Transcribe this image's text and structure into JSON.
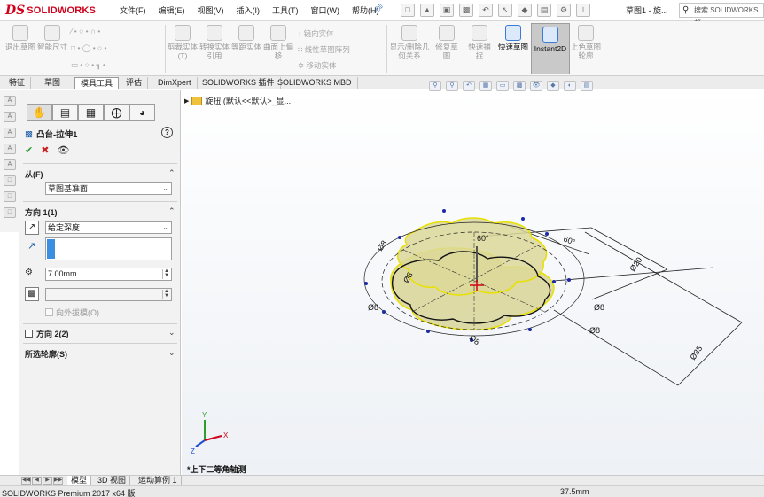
{
  "app": {
    "logo_ds": "DS",
    "logo_name": "SOLIDWORKS"
  },
  "menu": [
    "文件(F)",
    "编辑(E)",
    "视图(V)",
    "插入(I)",
    "工具(T)",
    "窗口(W)",
    "帮助(H)"
  ],
  "title": {
    "document": "草图1 - 旋...",
    "search_placeholder": "搜索 SOLIDWORKS 帮"
  },
  "ribbon": {
    "exit_sketch": "退出草图",
    "smart_dimension": "智能尺寸",
    "cut_entities": "剪裁实体(T)",
    "convert_entities": "转换实体引用",
    "offset_entities": "等距实体",
    "surface_offset": "曲面上偏移",
    "mirror_entities": "镜向实体",
    "linear_pattern": "线性草图阵列",
    "move_entities": "移动实体",
    "display_delete_relations": "显示/删除几何关系",
    "repair_sketch": "修复草图",
    "quick_snaps": "快速捕捉",
    "rapid_sketch": "快速草图",
    "instant2d": "Instant2D",
    "shaded_sketch": "上色草图轮廓"
  },
  "tabs": [
    "特征",
    "草图",
    "模具工具",
    "评估",
    "DimXpert",
    "SOLIDWORKS 插件",
    "SOLIDWORKS MBD"
  ],
  "active_tab": "模具工具",
  "property_manager": {
    "title": "凸台-拉伸1",
    "from_label": "从(F)",
    "from_value": "草图基准面",
    "direction1_label": "方向 1(1)",
    "end_condition": "给定深度",
    "depth": "7.00mm",
    "draft_outward": "向外拔模(O)",
    "direction2_label": "方向 2(2)",
    "selected_contours": "所选轮廓(S)"
  },
  "graphics": {
    "tree_item": "旋扭  (默认<<默认>_显...",
    "view_label": "*上下二等角轴测",
    "dims": [
      "Ø8",
      "Ø8",
      "Ø8",
      "Ø8",
      "Ø8",
      "Ø8",
      "60°",
      "60°",
      "Ø20",
      "Ø35"
    ],
    "triad": {
      "x": "X",
      "y": "Y",
      "z": "Z"
    }
  },
  "bottom_tabs": [
    "模型",
    "3D 视图",
    "运动算例 1"
  ],
  "status": {
    "left": "SOLIDWORKS Premium 2017 x64 版",
    "measure": "37.5mm"
  },
  "colors": {
    "brand": "#d0021b",
    "selection": "#3b8fe0",
    "body": "#d4d08a"
  }
}
